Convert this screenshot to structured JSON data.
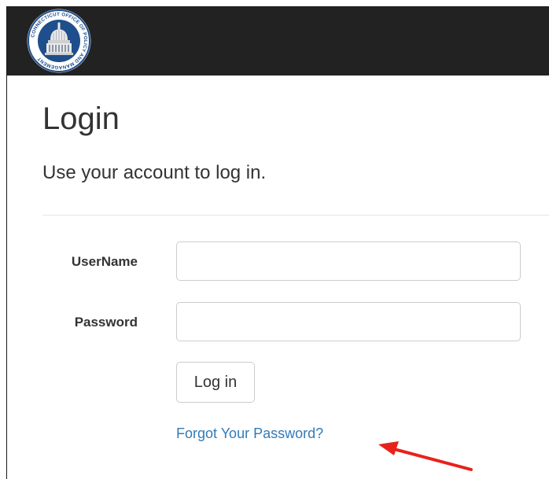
{
  "navbar": {
    "logo_icon": "connecticut-opm-seal-icon",
    "seal_text": "CONNECTICUT OFFICE OF POLICY AND MANAGEMENT",
    "background": "#222222"
  },
  "page": {
    "title": "Login",
    "subtitle": "Use your account to log in."
  },
  "form": {
    "username_label": "UserName",
    "username_value": "",
    "password_label": "Password",
    "password_value": "",
    "login_label": "Log in",
    "forgot_link": "Forgot Your Password?"
  },
  "annotation": {
    "icon": "red-arrow-icon",
    "color": "#e8211b"
  },
  "colors": {
    "link": "#337ab7",
    "text": "#333333",
    "seal_blue": "#1f4e8c"
  }
}
